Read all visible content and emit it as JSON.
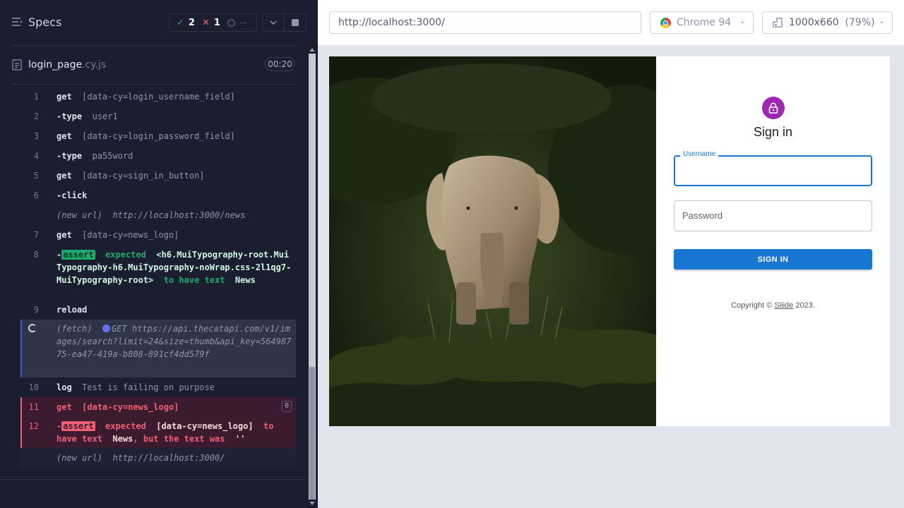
{
  "specs_header": {
    "title": "Specs",
    "passed_count": "2",
    "failed_count": "1",
    "pending_count": "--"
  },
  "spec_file": {
    "name": "login_page",
    "extension": ".cy.js",
    "duration": "00:20"
  },
  "commands": [
    {
      "num": "1",
      "name": "get",
      "message": "[data-cy=login_username_field]"
    },
    {
      "num": "2",
      "prefix": "-",
      "name": "type",
      "message": "user1"
    },
    {
      "num": "3",
      "name": "get",
      "message": "[data-cy=login_password_field]"
    },
    {
      "num": "4",
      "prefix": "-",
      "name": "type",
      "message": "pa55word"
    },
    {
      "num": "5",
      "name": "get",
      "message": "[data-cy=sign_in_button]"
    },
    {
      "num": "6",
      "prefix": "-",
      "name": "click",
      "message": ""
    },
    {
      "num": "",
      "name": "(new url)",
      "message": "http://localhost:3000/news"
    },
    {
      "num": "7",
      "name": "get",
      "message": "[data-cy=news_logo]"
    },
    {
      "num": "8",
      "prefix": "-",
      "name": "assert",
      "expected": "expected",
      "subject": "<h6.MuiTypography-root.MuiTypography-h6.MuiTypography-noWrap.css-2l1qg7-MuiTypography-root>",
      "to_have": "to have text",
      "value": "News"
    },
    {
      "num": "9",
      "name": "reload",
      "message": ""
    },
    {
      "num": "",
      "name": "(fetch)",
      "method": "GET",
      "message": "https://api.thecatapi.com/v1/images/search?limit=24&size=thumb&api_key=56498775-ea47-419a-b808-891cf4dd579f"
    },
    {
      "num": "10",
      "name": "log",
      "message": "Test is failing on purpose"
    },
    {
      "num": "11",
      "name": "get",
      "message": "[data-cy=news_logo]",
      "badge": "0"
    },
    {
      "num": "12",
      "prefix": "-",
      "name": "assert",
      "expected": "expected",
      "subject": "[data-cy=news_logo]",
      "to_have": "to have text",
      "value": "News",
      "but": ", but the text was",
      "actual": "''"
    },
    {
      "num": "",
      "name": "(new url)",
      "message": "http://localhost:3000/"
    }
  ],
  "aut_header": {
    "url": "http://localhost:3000/",
    "browser": "Chrome 94",
    "viewport": "1000x660",
    "zoom": "(79%)"
  },
  "app": {
    "signin_title": "Sign in",
    "username_label": "Username",
    "password_placeholder": "Password",
    "signin_button": "SIGN IN",
    "copyright_prefix": "Copyright © ",
    "copyright_link": "Sliide",
    "copyright_suffix": " 2023."
  },
  "colors": {
    "passed": "#1fa971",
    "failed": "#f15f72",
    "accent": "#6470f3",
    "mui_primary": "#1976d2",
    "mui_avatar": "#9c27b0"
  }
}
